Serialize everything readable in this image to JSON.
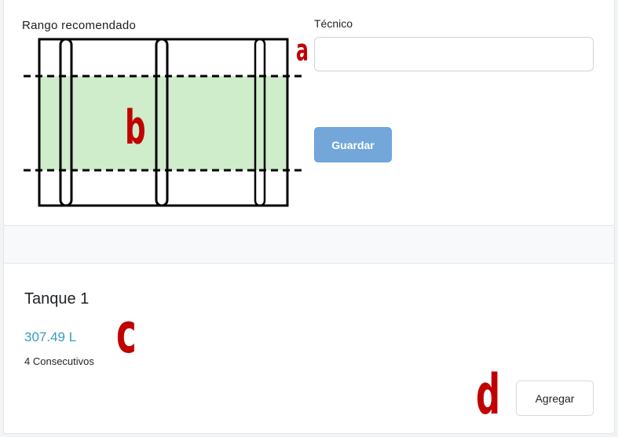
{
  "range_panel": {
    "label": "Rango recomendado"
  },
  "technician": {
    "label": "Técnico",
    "value": "",
    "placeholder": ""
  },
  "save_button": {
    "label": "Guardar"
  },
  "tank": {
    "title": "Tanque 1",
    "volume": "307.49 L",
    "consecutive": "4 Consecutivos"
  },
  "add_button": {
    "label": "Agregar"
  },
  "annotations": {
    "a": "a",
    "b": "b",
    "c": "c",
    "d": "d"
  },
  "colors": {
    "range_fill": "#cfeccb",
    "save_button": "#73a7da",
    "volume_text": "#3a9cc2",
    "marker_red": "#c00000"
  }
}
